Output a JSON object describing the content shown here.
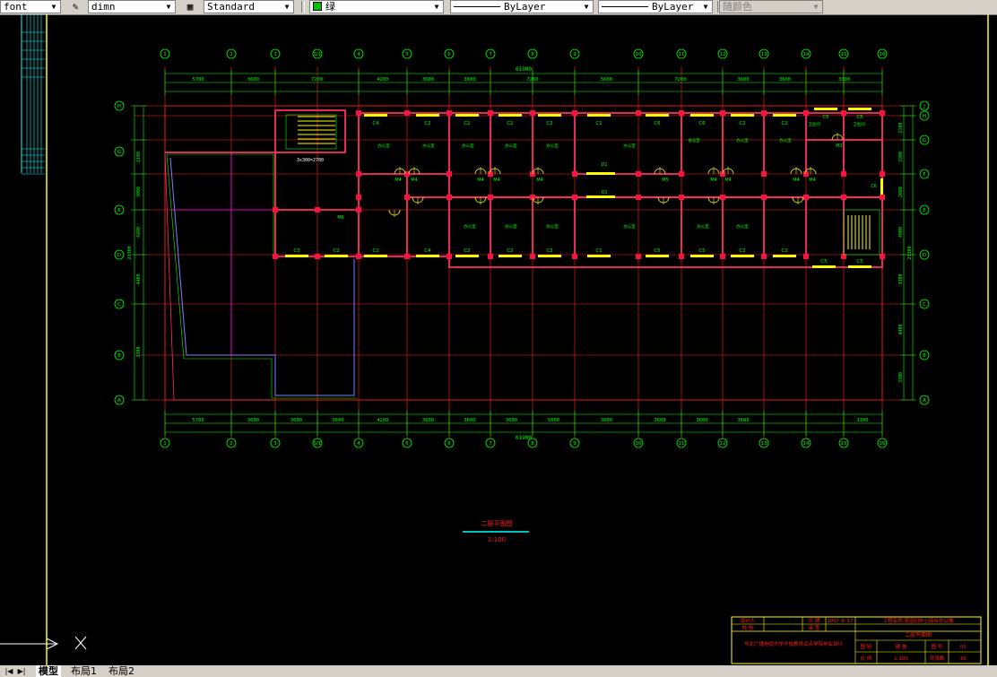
{
  "toolbar": {
    "text_style": "font",
    "dim_style": "dimn",
    "table_style": "Standard",
    "color": "绿",
    "linetype": "ByLayer",
    "lineweight": "ByLayer",
    "plot_style": "随颜色"
  },
  "drawing": {
    "total_dim": "61900",
    "top_dims": [
      "5700",
      "3600",
      "7200",
      "4200",
      "3600",
      "3600",
      "7200",
      "5600",
      "7200",
      "3600",
      "3600",
      "3300"
    ],
    "bottom_dims": [
      "5700",
      "3600",
      "3600",
      "3600",
      "4200",
      "3600",
      "3600",
      "3600",
      "5600",
      "3600",
      "3600",
      "3600",
      "3600",
      "3300"
    ],
    "grid_numbers": [
      "1",
      "2",
      "3",
      "3/1",
      "4",
      "5",
      "6",
      "7",
      "8",
      "9",
      "10",
      "11",
      "12",
      "13",
      "14",
      "15",
      "16"
    ],
    "grid_letters": [
      "J",
      "H",
      "G",
      "F",
      "E",
      "D",
      "C",
      "B",
      "A"
    ],
    "left_letters": [
      "H",
      "G",
      "E",
      "D",
      "C",
      "B",
      "A"
    ],
    "left_dims": [
      "2100",
      "3000",
      "4200",
      "4400",
      "3300",
      "23300"
    ],
    "right_dims": [
      "2100",
      "3300",
      "2000",
      "4000",
      "3300",
      "4400",
      "3300",
      "23300"
    ],
    "doors": [
      "M4",
      "M4",
      "M4",
      "M4",
      "M4",
      "M5",
      "M4",
      "M4",
      "M4",
      "M4",
      "M3",
      "M6"
    ],
    "windows": [
      "C4",
      "C2",
      "C2",
      "C2",
      "C2",
      "C1",
      "C6",
      "C6",
      "C2",
      "C2",
      "C5",
      "C5",
      "C3",
      "C2",
      "C2",
      "C4",
      "C2",
      "C2",
      "C2",
      "C1",
      "C5",
      "C5",
      "C2",
      "C2",
      "C5",
      "C5",
      "C6"
    ],
    "rooms": [
      "办公室",
      "办公室",
      "办公室",
      "办公室",
      "办公室",
      "办公室",
      "会议室",
      "办公室",
      "办公室",
      "办公室",
      "办公室",
      "办公室",
      "办公室",
      "办公室",
      "办公室",
      "卫生间",
      "卫生间"
    ],
    "stair_note": "3x300=2700",
    "corridor_labels": [
      "D1",
      "D1"
    ],
    "plan_title": "二层平面图",
    "plan_scale": "1:100"
  },
  "title_block": {
    "designer_label": "设计人",
    "checker_label": "校 核",
    "date_label": "日 期",
    "date_value": "2007. 8. 17",
    "project": "工程名称:某培训中心综合办公楼",
    "reviewer_label": "审 查",
    "drawing_name": "二层平面图",
    "school": "华北广播电视大学开放教育试点学院毕业设计",
    "category_label": "图 别",
    "category_value": "建 施",
    "number_label": "图 号",
    "number_value": "03",
    "scale_label": "比 例",
    "scale_value": "1:100",
    "sheets_label": "共张数",
    "sheets_value": "10"
  },
  "tabs": [
    "模型",
    "布局1",
    "布局2"
  ],
  "colors": {
    "grid": "#ff2020",
    "dimension": "#00ff00",
    "wall": "#ff3060",
    "column": "#ff1040",
    "window": "#ffff00",
    "door": "#ffff00",
    "border": "#ffff00",
    "text_green": "#00ff00",
    "magenta": "#ff00ff",
    "cyan": "#00ffff"
  }
}
